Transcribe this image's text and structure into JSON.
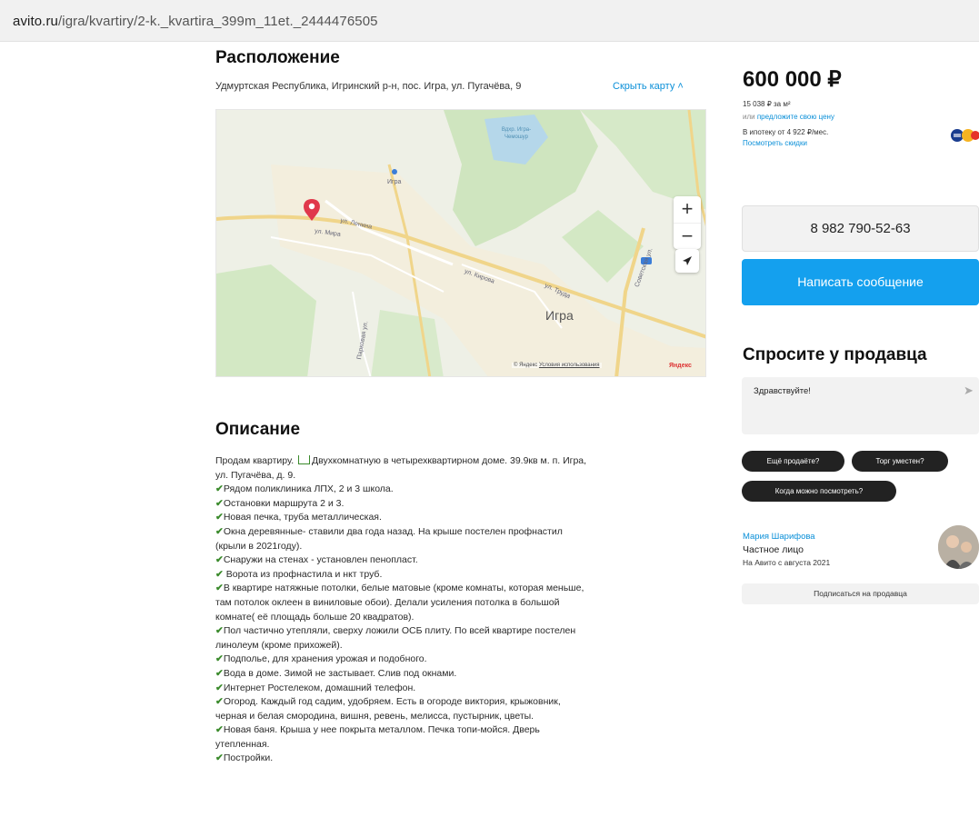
{
  "browser": {
    "url_host": "avito.ru",
    "url_path": "/igra/kvartiry/2-k._kvartira_399m_11et._2444476505"
  },
  "location": {
    "title": "Расположение",
    "address": "Удмуртская Республика, Игринский р-н, пос. Игра, ул. Пугачёва, 9",
    "hide_map": "Скрыть карту",
    "map": {
      "water_label": "Вдхр. Игра-Чемошур",
      "poi_label": "Игра",
      "street_1": "ул. Ленина",
      "street_2": "ул. Мира",
      "street_3": "ул. Кирова",
      "street_4": "ул. Труда",
      "street_5": "Советская ул.",
      "street_6": "Парковая ул.",
      "town_label": "Игра",
      "zoom_in": "+",
      "zoom_out": "−",
      "attribution": "© Яндекс",
      "terms": "Условия использования",
      "brand": "Яндекс"
    }
  },
  "description": {
    "title": "Описание",
    "intro_a": "Продам квартиру.",
    "intro_b": "Двухкомнатную в четырехквартирном доме. 39.9кв м. п. Игра,",
    "intro_c": "ул. Пугачёва, д. 9.",
    "check_mark": "✔",
    "lines": [
      [
        "Рядом поликлиника ЛПХ, 2 и 3 школа."
      ],
      [
        "Остановки маршрута 2 и 3."
      ],
      [
        "Новая печка, труба металлическая."
      ],
      [
        "Окна деревянные- ставили два года назад. На крыше постелен профнастил",
        "(крыли в 2021году)."
      ],
      [
        "Снаружи на стенах - установлен пенопласт."
      ],
      [
        " Ворота из профнастила и нкт труб."
      ],
      [
        "В квартире натяжные потолки, белые матовые (кроме комнаты, которая меньше,",
        "там потолок оклеен в виниловые обои). Делали усиления потолка в большой",
        "комнате( её площадь больше 20 квадратов)."
      ],
      [
        "Пол частично утепляли, сверху ложили ОСБ плиту. По всей квартире постелен",
        "линолеум (кроме прихожей)."
      ],
      [
        "Подполье, для хранения урожая и подобного."
      ],
      [
        "Вода в доме. Зимой не застывает. Слив под окнами."
      ],
      [
        "Интернет Ростелеком, домашний телефон."
      ],
      [
        "Огород. Каждый год садим, удобряем. Есть в огороде виктория, крыжовник,",
        "черная и белая смородина, вишня, ревень, мелисса, пустырник, цветы."
      ],
      [
        "Новая баня. Крыша у нее покрыта металлом. Печка топи-мойся. Дверь",
        "утепленная."
      ],
      [
        "Постройки."
      ]
    ]
  },
  "sidebar": {
    "price": "600 000 ₽",
    "price_per_m2": "15 038 ₽ за м²",
    "offer_prefix": "или",
    "offer_link": "предложите свою цену",
    "mortgage": "В ипотеку от 4 922 ₽/мес.",
    "discounts": "Посмотреть скидки",
    "phone": "8 982 790-52-63",
    "message": "Написать сообщение",
    "ask_title": "Спросите у продавца",
    "ask_value": "Здравствуйте!",
    "send_icon": "➤",
    "chips": [
      "Ещё продаёте?",
      "Торг уместен?",
      "Когда можно посмотреть?"
    ],
    "seller_name": "Мария Шарифова",
    "seller_type": "Частное лицо",
    "seller_since": "На Авито с августа 2021",
    "subscribe": "Подписаться на продавца"
  },
  "colors": {
    "accent": "#14a0ee",
    "link": "#0a8fd8",
    "check": "#3a8a2b",
    "pin": "#e0384b"
  }
}
